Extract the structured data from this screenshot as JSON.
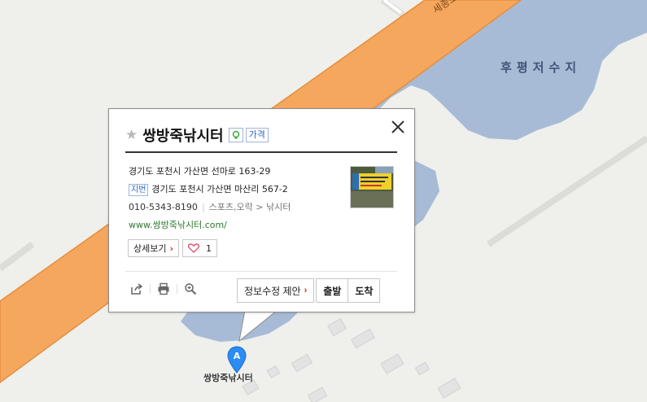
{
  "map": {
    "lake_label": "후평저수지",
    "road_label": "세종포천",
    "marker_letter": "A",
    "marker_label": "쌍방죽낚시터",
    "colors": {
      "land": "#efefec",
      "water": "#a7bbd6",
      "road": "#f6a75e",
      "road_edge": "#e58e3d",
      "building": "#e3e3e3",
      "marker": "#2b8cf2"
    }
  },
  "popup": {
    "title": "쌍방죽낚시터",
    "star_icon": "star-icon",
    "badge_icon": "lightbulb-icon",
    "badge_text": "가격",
    "road_address": "경기도 포천시 가산면 선마로 163-29",
    "jibun_label": "지번",
    "jibun_address": "경기도 포천시 가산면 마산리 567-2",
    "phone": "010-5343-8190",
    "category_parent": "스포츠,오락",
    "category_arrow": ">",
    "category_child": "낚시터",
    "website": "www.쌍방죽낚시터.com/",
    "detail_button": "상세보기",
    "like_count": "1",
    "suggest_button": "정보수정 제안",
    "depart_button": "출발",
    "arrive_button": "도착",
    "tools": [
      "share-icon",
      "print-icon",
      "zoom-icon"
    ]
  }
}
